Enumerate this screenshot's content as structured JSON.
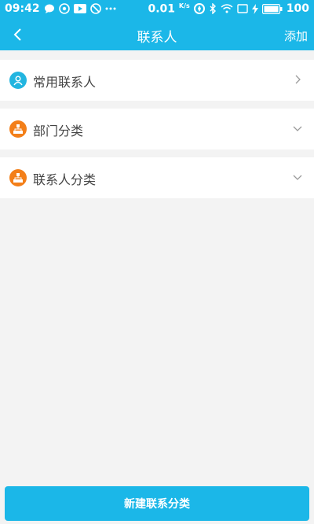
{
  "status_bar": {
    "time": "09:42",
    "net_speed": "0.01",
    "net_unit": "K/s",
    "battery": "100"
  },
  "header": {
    "title": "联系人",
    "action_label": "添加",
    "back_icon": "chevron-left-icon"
  },
  "sections": [
    {
      "label": "常用联系人",
      "icon": "person-icon",
      "icon_color": "#22b5e0",
      "arrow": "chevron-right-icon"
    },
    {
      "label": "部门分类",
      "icon": "org-chart-icon",
      "icon_color": "#f37f19",
      "arrow": "chevron-down-icon"
    },
    {
      "label": "联系人分类",
      "icon": "org-chart-icon",
      "icon_color": "#f37f19",
      "arrow": "chevron-down-icon"
    }
  ],
  "footer": {
    "new_category_label": "新建联系分类"
  },
  "colors": {
    "accent": "#1bb7e8",
    "background": "#f3f3f3"
  }
}
